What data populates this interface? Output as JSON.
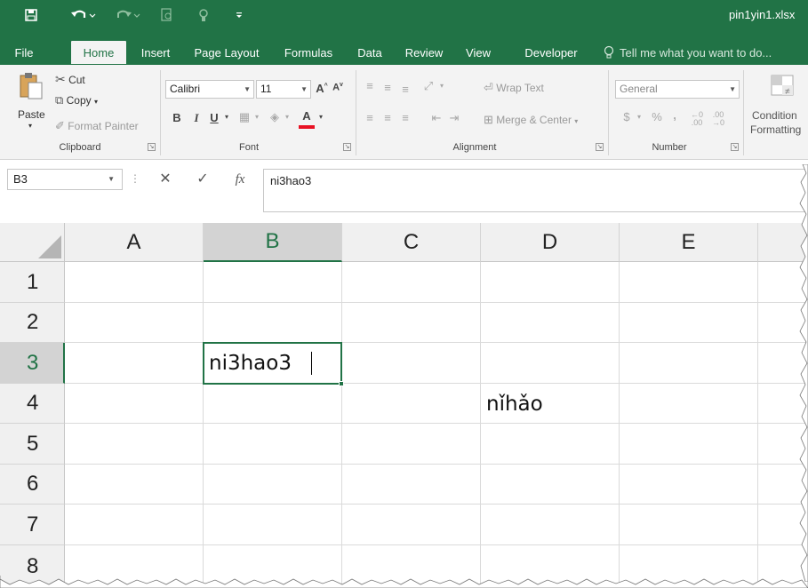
{
  "window": {
    "title": "pin1yin1.xlsx"
  },
  "qat": {
    "save_icon": "save-icon",
    "undo_icon": "undo-icon",
    "redo_icon": "redo-icon",
    "print_preview_icon": "print-preview-icon",
    "customize_icon": "touch-mode-icon",
    "more_icon": "customize-qat-icon"
  },
  "tabs": [
    "File",
    "Home",
    "Insert",
    "Page Layout",
    "Formulas",
    "Data",
    "Review",
    "View",
    "Developer"
  ],
  "active_tab": "Home",
  "tell_me": "Tell me what you want to do...",
  "ribbon": {
    "clipboard": {
      "paste": "Paste",
      "cut": "Cut",
      "copy": "Copy",
      "format_painter": "Format Painter",
      "label": "Clipboard"
    },
    "font": {
      "name": "Calibri",
      "size": "11",
      "label": "Font",
      "bold": "B",
      "italic": "I",
      "underline": "U",
      "font_color": "A"
    },
    "alignment": {
      "wrap_text": "Wrap Text",
      "merge_center": "Merge & Center",
      "label": "Alignment"
    },
    "number": {
      "format": "General",
      "currency": "$",
      "percent": "%",
      "comma": ",",
      "label": "Number"
    },
    "styles": {
      "conditional_line1": "Condition",
      "conditional_line2": "Formatting"
    }
  },
  "formula_bar": {
    "name_box": "B3",
    "fx": "fx",
    "value": "ni3hao3"
  },
  "grid": {
    "columns": [
      "A",
      "B",
      "C",
      "D",
      "E"
    ],
    "rows": [
      "1",
      "2",
      "3",
      "4",
      "5",
      "6",
      "7",
      "8"
    ],
    "selected_column": "B",
    "selected_row": "3",
    "cells": {
      "B3": "ni3hao3",
      "D4": "nǐhǎo"
    }
  },
  "colors": {
    "accent": "#217346",
    "ribbon_bg": "#f3f3f3",
    "header_bg": "#f0f0f0",
    "header_selected": "#d3d3d3",
    "font_color_bar": "#e81123"
  }
}
